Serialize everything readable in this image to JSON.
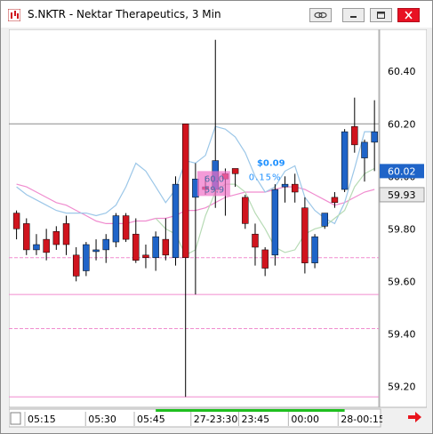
{
  "window": {
    "title": "S.NKTR - Nektar Therapeutics, 3 Min",
    "buttons": [
      "link-icon",
      "minimize-icon",
      "restore-icon",
      "close-icon"
    ]
  },
  "chart_data": {
    "type": "candlestick",
    "ylim": [
      59.12,
      60.56
    ],
    "y_ticks": [
      "60.40",
      "60.20",
      "60.00",
      "59.80",
      "59.60",
      "59.40",
      "59.20"
    ],
    "y_tick_values": [
      60.4,
      60.2,
      60.0,
      59.8,
      59.6,
      59.4,
      59.2
    ],
    "x_ticks": [
      "05:15",
      "05:30",
      "05:45",
      "27-23:30",
      "23:45",
      "00:00",
      "28-00:15"
    ],
    "x_tick_bar_index": [
      1.2,
      7.3,
      12.2,
      17.9,
      22.7,
      27.7,
      32.7
    ],
    "last_price_label": "60.02",
    "last_price": 60.02,
    "secondary_price_label": "59.93",
    "secondary_price": 59.93,
    "measurement": {
      "change": "$0.09",
      "percent": "0.15%",
      "label_a": "60.0",
      "label_b": "59.9"
    },
    "colors": {
      "up": "#1f64c8",
      "down": "#d0141e",
      "ma_blue": "#9cc7e8",
      "ma_pink": "#f08ccf",
      "ma_green": "#b7dbb5",
      "measure_box": "#f070c8",
      "measure_text": "#1e90ff",
      "price_label_bg": "#1f64c8"
    },
    "candles": [
      {
        "o": 59.86,
        "h": 59.87,
        "l": 59.76,
        "c": 59.8
      },
      {
        "o": 59.82,
        "h": 59.84,
        "l": 59.7,
        "c": 59.72
      },
      {
        "o": 59.72,
        "h": 59.78,
        "l": 59.7,
        "c": 59.74
      },
      {
        "o": 59.76,
        "h": 59.8,
        "l": 59.68,
        "c": 59.71
      },
      {
        "o": 59.79,
        "h": 59.81,
        "l": 59.72,
        "c": 59.74
      },
      {
        "o": 59.82,
        "h": 59.85,
        "l": 59.7,
        "c": 59.74
      },
      {
        "o": 59.7,
        "h": 59.73,
        "l": 59.6,
        "c": 59.62
      },
      {
        "o": 59.64,
        "h": 59.75,
        "l": 59.62,
        "c": 59.74
      },
      {
        "o": 59.72,
        "h": 59.76,
        "l": 59.68,
        "c": 59.72
      },
      {
        "o": 59.72,
        "h": 59.78,
        "l": 59.67,
        "c": 59.76
      },
      {
        "o": 59.75,
        "h": 59.86,
        "l": 59.73,
        "c": 59.85
      },
      {
        "o": 59.85,
        "h": 59.86,
        "l": 59.75,
        "c": 59.76
      },
      {
        "o": 59.78,
        "h": 59.84,
        "l": 59.67,
        "c": 59.68
      },
      {
        "o": 59.7,
        "h": 59.74,
        "l": 59.65,
        "c": 59.69
      },
      {
        "o": 59.69,
        "h": 59.79,
        "l": 59.64,
        "c": 59.77
      },
      {
        "o": 59.76,
        "h": 59.84,
        "l": 59.68,
        "c": 59.7
      },
      {
        "o": 59.69,
        "h": 60.0,
        "l": 59.66,
        "c": 59.97
      },
      {
        "o": 60.2,
        "h": 60.2,
        "l": 59.16,
        "c": 59.69
      },
      {
        "o": 59.92,
        "h": 60.05,
        "l": 59.55,
        "c": 59.99
      },
      {
        "o": 59.96,
        "h": 60.0,
        "l": 59.93,
        "c": 59.95
      },
      {
        "o": 59.95,
        "h": 60.52,
        "l": 59.88,
        "c": 60.06
      },
      {
        "o": 60.01,
        "h": 60.03,
        "l": 59.85,
        "c": 59.99
      },
      {
        "o": 60.03,
        "h": 60.02,
        "l": 59.96,
        "c": 60.01
      },
      {
        "o": 59.92,
        "h": 59.93,
        "l": 59.8,
        "c": 59.82
      },
      {
        "o": 59.78,
        "h": 59.82,
        "l": 59.66,
        "c": 59.73
      },
      {
        "o": 59.72,
        "h": 59.73,
        "l": 59.62,
        "c": 59.65
      },
      {
        "o": 59.7,
        "h": 59.97,
        "l": 59.66,
        "c": 59.95
      },
      {
        "o": 59.96,
        "h": 60.0,
        "l": 59.9,
        "c": 59.97
      },
      {
        "o": 59.97,
        "h": 60.01,
        "l": 59.9,
        "c": 59.94
      },
      {
        "o": 59.88,
        "h": 59.92,
        "l": 59.63,
        "c": 59.67
      },
      {
        "o": 59.67,
        "h": 59.78,
        "l": 59.65,
        "c": 59.77
      },
      {
        "o": 59.81,
        "h": 59.86,
        "l": 59.8,
        "c": 59.86
      },
      {
        "o": 59.92,
        "h": 59.94,
        "l": 59.88,
        "c": 59.9
      },
      {
        "o": 59.95,
        "h": 60.18,
        "l": 59.94,
        "c": 60.17
      },
      {
        "o": 60.19,
        "h": 60.3,
        "l": 60.09,
        "c": 60.12
      },
      {
        "o": 60.07,
        "h": 60.14,
        "l": 59.98,
        "c": 60.13
      },
      {
        "o": 60.13,
        "h": 60.29,
        "l": 60.02,
        "c": 60.17
      }
    ],
    "ma_blue": [
      59.96,
      59.93,
      59.91,
      59.89,
      59.87,
      59.86,
      59.86,
      59.86,
      59.85,
      59.86,
      59.89,
      59.96,
      60.05,
      60.02,
      59.96,
      59.9,
      59.95,
      60.06,
      60.05,
      60.08,
      60.19,
      60.18,
      60.15,
      60.09,
      60.0,
      59.94,
      59.96,
      60.02,
      60.04,
      59.92,
      59.87,
      59.84,
      59.82,
      59.9,
      60.03,
      60.17,
      60.17
    ],
    "ma_pink": [
      59.97,
      59.96,
      59.94,
      59.92,
      59.9,
      59.89,
      59.87,
      59.85,
      59.83,
      59.82,
      59.82,
      59.82,
      59.83,
      59.83,
      59.84,
      59.84,
      59.85,
      59.87,
      59.87,
      59.88,
      59.9,
      59.92,
      59.93,
      59.94,
      59.94,
      59.94,
      59.95,
      59.96,
      59.96,
      59.95,
      59.93,
      59.91,
      59.89,
      59.9,
      59.92,
      59.94,
      59.95
    ],
    "ma_green": [
      null,
      null,
      null,
      null,
      null,
      null,
      null,
      null,
      null,
      null,
      null,
      null,
      null,
      null,
      59.84,
      59.8,
      59.78,
      59.7,
      59.72,
      59.85,
      59.94,
      59.97,
      59.97,
      59.94,
      59.86,
      59.8,
      59.73,
      59.71,
      59.72,
      59.78,
      59.8,
      59.81,
      59.84,
      59.87,
      59.96,
      60.01,
      60.03
    ],
    "h_lines": [
      {
        "value": 60.2,
        "color": "#8c8c8c",
        "dash": false
      },
      {
        "value": 59.69,
        "color": "#f08ccf",
        "dash": true
      },
      {
        "value": 59.55,
        "color": "#f08ccf",
        "dash": false
      },
      {
        "value": 59.42,
        "color": "#f08ccf",
        "dash": true
      },
      {
        "value": 59.16,
        "color": "#f08ccf",
        "dash": false
      }
    ]
  }
}
